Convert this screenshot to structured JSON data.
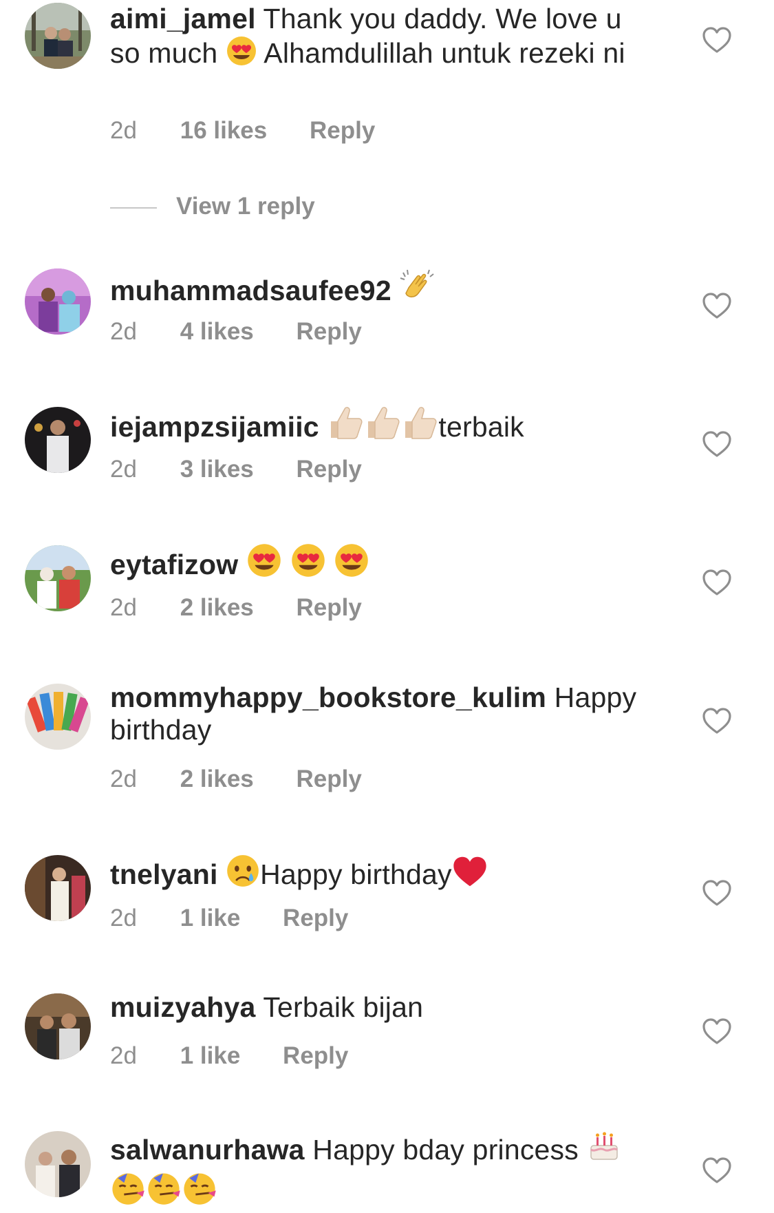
{
  "comments": [
    {
      "username": "aimi_jamel",
      "text_before": "Thank you daddy. We love u so much",
      "text_after": "Alhamdulillah untuk rezeki ni",
      "time": "2d",
      "likes": "16 likes",
      "reply_label": "Reply",
      "view_replies": "View 1 reply"
    },
    {
      "username": "muhammadsaufee92",
      "time": "2d",
      "likes": "4 likes",
      "reply_label": "Reply"
    },
    {
      "username": "iejampzsijamiic",
      "text_after": "terbaik",
      "time": "2d",
      "likes": "3 likes",
      "reply_label": "Reply"
    },
    {
      "username": "eytafizow",
      "time": "2d",
      "likes": "2 likes",
      "reply_label": "Reply"
    },
    {
      "username": "mommyhappy_bookstore_kulim",
      "text": "Happy birthday",
      "time": "2d",
      "likes": "2 likes",
      "reply_label": "Reply"
    },
    {
      "username": "tnelyani",
      "text": "Happy birthday",
      "time": "2d",
      "likes": "1 like",
      "reply_label": "Reply"
    },
    {
      "username": "muizyahya",
      "text": "Terbaik bijan",
      "time": "2d",
      "likes": "1 like",
      "reply_label": "Reply"
    },
    {
      "username": "salwanurhawa",
      "text": "Happy bday princess"
    }
  ],
  "icons": {
    "like": "heart-outline-icon"
  },
  "colors": {
    "text": "#262626",
    "meta": "#8e8e8e"
  }
}
